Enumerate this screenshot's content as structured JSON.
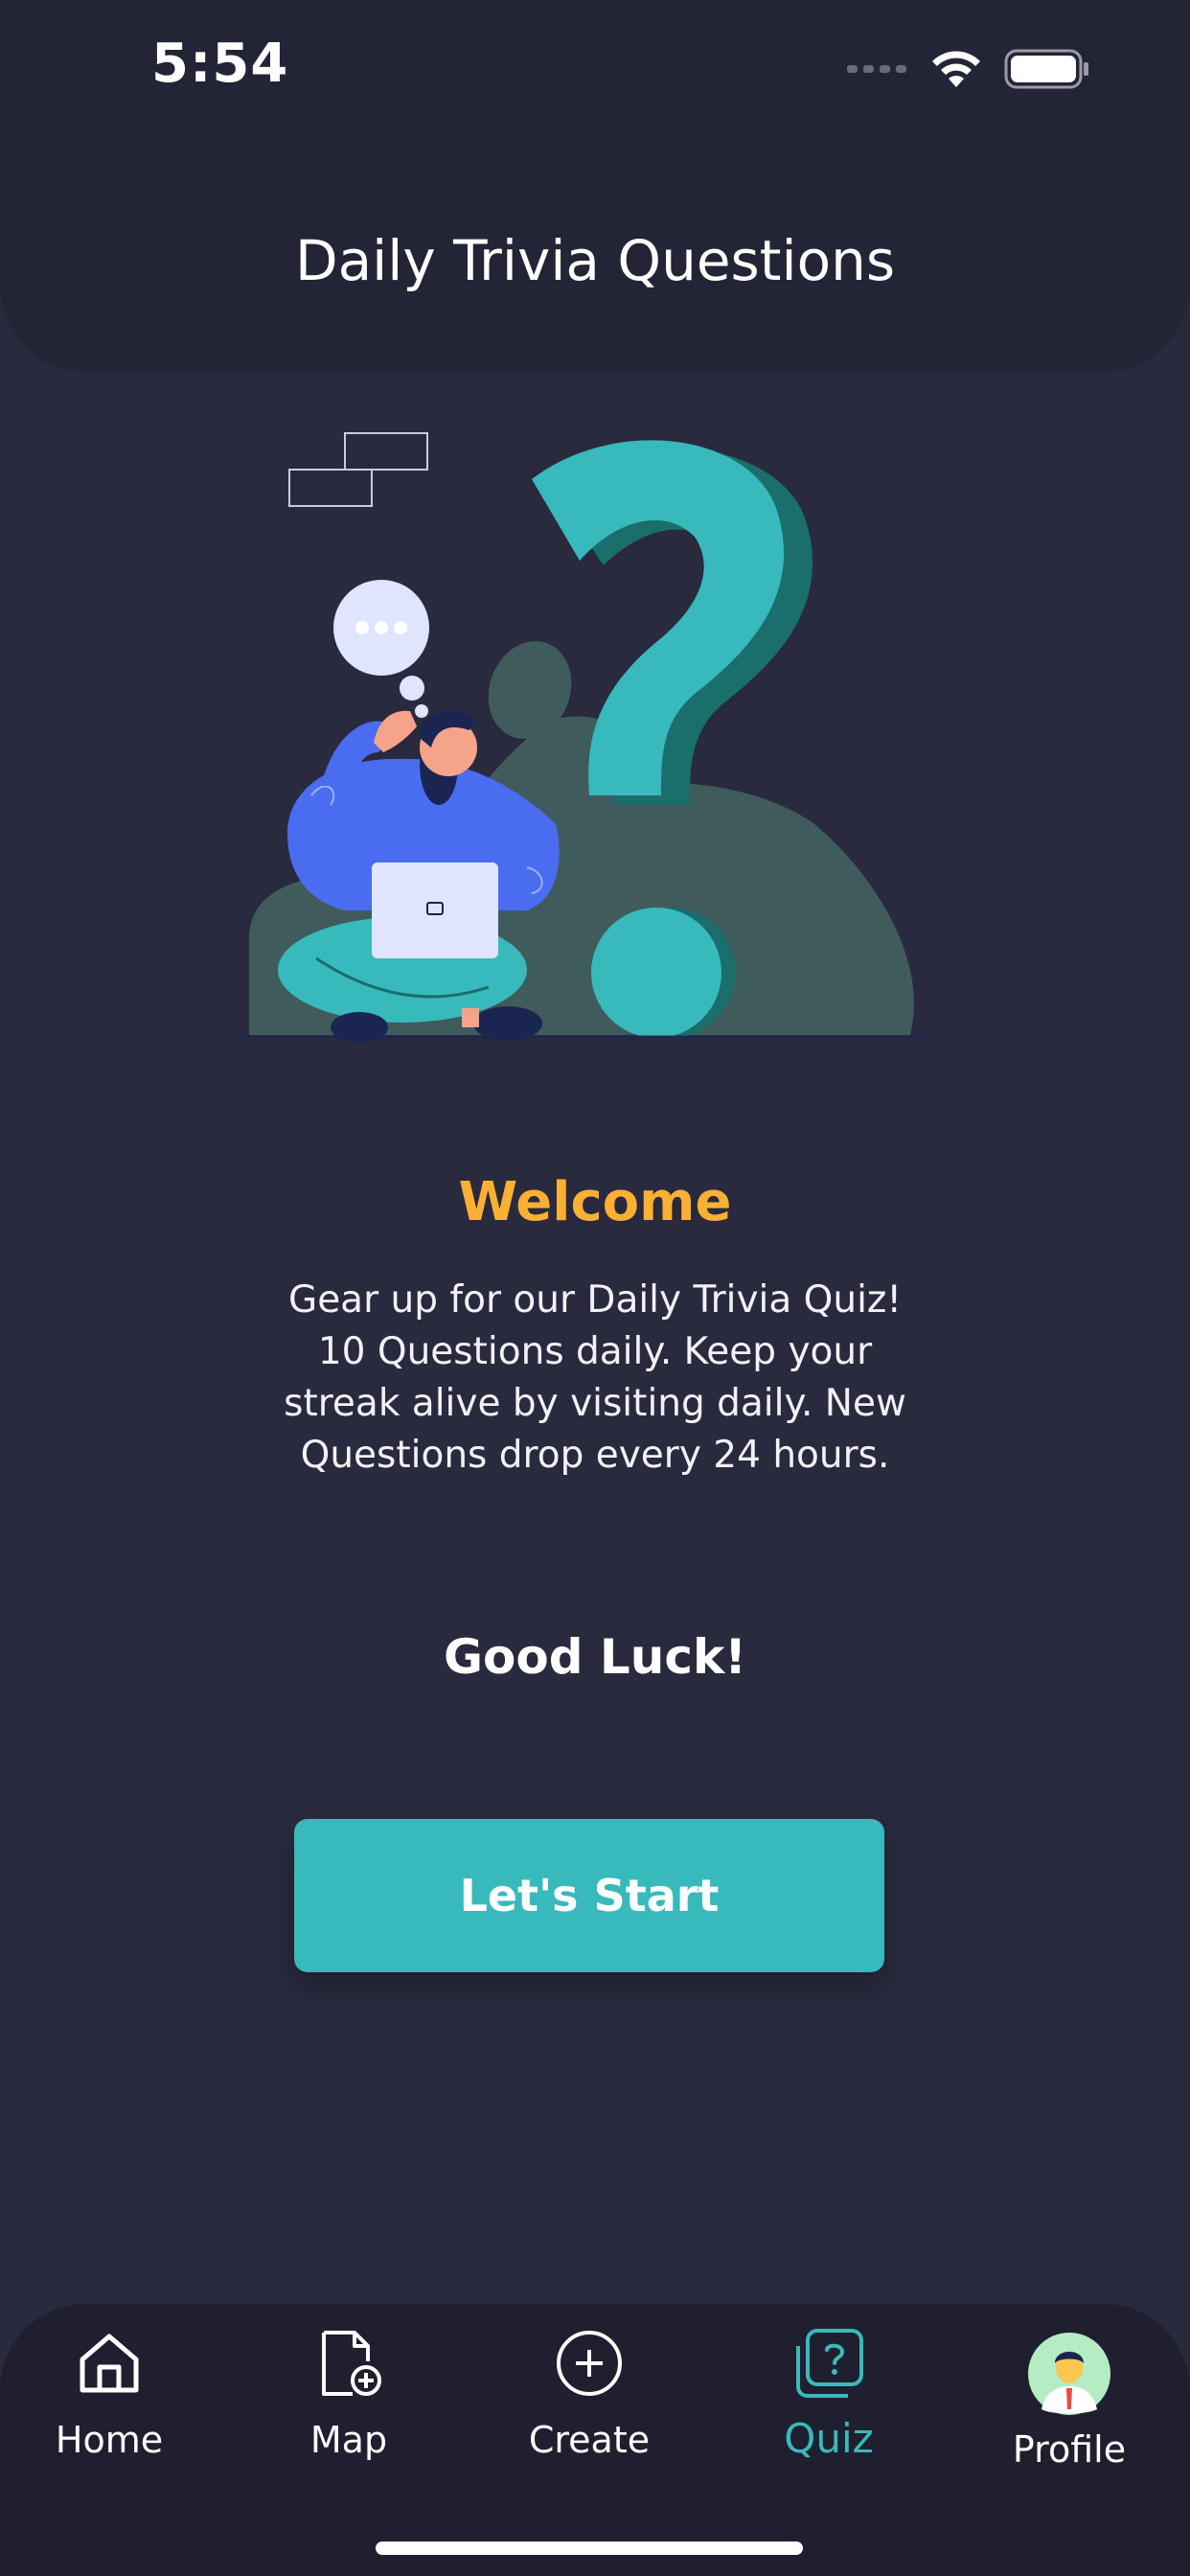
{
  "status_bar": {
    "time": "5:54"
  },
  "header": {
    "title": "Daily Trivia Questions"
  },
  "content": {
    "welcome": "Welcome",
    "description": "Gear up for our Daily Trivia Quiz! 10 Questions daily. Keep your streak alive by visiting daily. New Questions drop every 24 hours.",
    "good_luck": "Good Luck!",
    "start_button_label": "Let's Start"
  },
  "nav": {
    "items": [
      {
        "label": "Home",
        "icon": "home-icon"
      },
      {
        "label": "Map",
        "icon": "document-add-icon"
      },
      {
        "label": "Create",
        "icon": "plus-circle-icon"
      },
      {
        "label": "Quiz",
        "icon": "quiz-icon",
        "active": true
      },
      {
        "label": "Profile",
        "icon": "avatar"
      }
    ]
  },
  "colors": {
    "background": "#2a2a3f",
    "header": "#242437",
    "accent": "#38b9bb",
    "welcome": "#fbb034",
    "nav_background": "#1f1f30"
  }
}
